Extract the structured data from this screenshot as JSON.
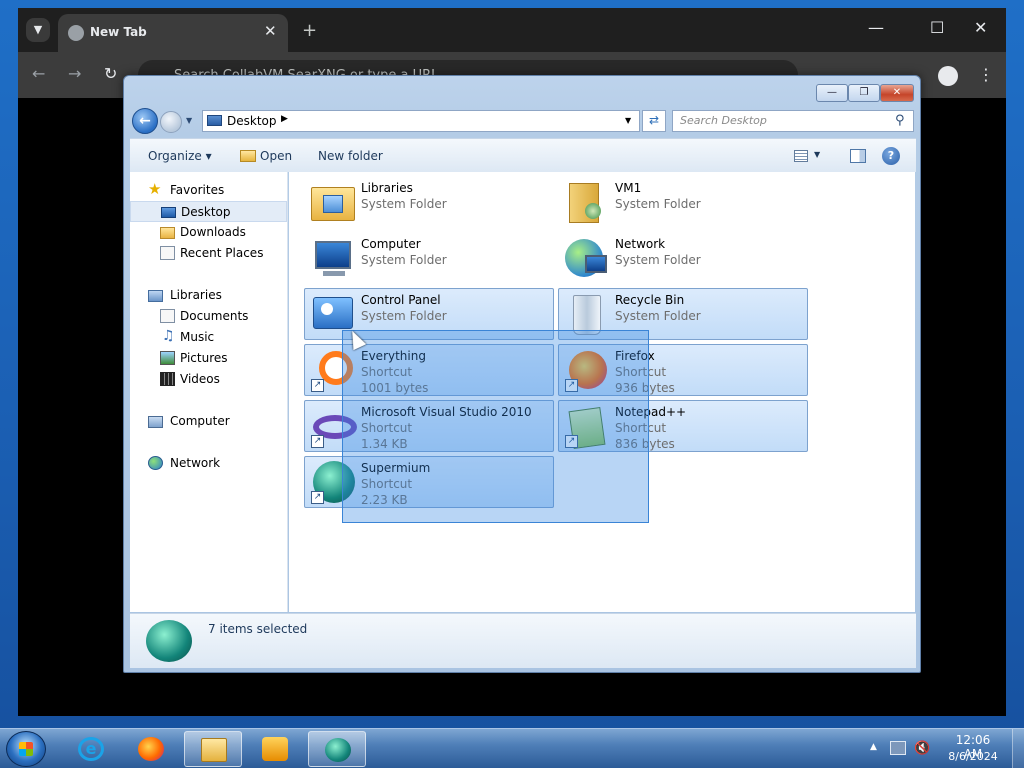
{
  "browser": {
    "tab_title": "New Tab",
    "omnibox_placeholder": "Search CollabVM SearXNG or type a URL"
  },
  "explorer": {
    "address_path": "Desktop",
    "search_placeholder": "Search Desktop",
    "command_bar": {
      "organize": "Organize",
      "open": "Open",
      "new_folder": "New folder",
      "help_label": "?"
    },
    "nav": {
      "favorites": "Favorites",
      "desktop": "Desktop",
      "downloads": "Downloads",
      "recent_places": "Recent Places",
      "libraries": "Libraries",
      "documents": "Documents",
      "music": "Music",
      "pictures": "Pictures",
      "videos": "Videos",
      "computer": "Computer",
      "network": "Network"
    },
    "items": [
      {
        "name": "Libraries",
        "type": "System Folder",
        "size": ""
      },
      {
        "name": "VM1",
        "type": "System Folder",
        "size": ""
      },
      {
        "name": "Computer",
        "type": "System Folder",
        "size": ""
      },
      {
        "name": "Network",
        "type": "System Folder",
        "size": ""
      },
      {
        "name": "Control Panel",
        "type": "System Folder",
        "size": ""
      },
      {
        "name": "Recycle Bin",
        "type": "System Folder",
        "size": ""
      },
      {
        "name": "Everything",
        "type": "Shortcut",
        "size": "1001 bytes"
      },
      {
        "name": "Firefox",
        "type": "Shortcut",
        "size": "936 bytes"
      },
      {
        "name": "Microsoft Visual Studio 2010",
        "type": "Shortcut",
        "size": "1.34 KB"
      },
      {
        "name": "Notepad++",
        "type": "Shortcut",
        "size": "836 bytes"
      },
      {
        "name": "Supermium",
        "type": "Shortcut",
        "size": "2.23 KB"
      }
    ],
    "status": "7 items selected"
  },
  "taskbar": {
    "time": "12:06 AM",
    "date": "8/6/2024"
  },
  "icons": {
    "tab": "globe-icon",
    "back": "back-arrow-icon",
    "forward": "forward-arrow-icon",
    "search": "search-icon",
    "help": "help-icon"
  }
}
